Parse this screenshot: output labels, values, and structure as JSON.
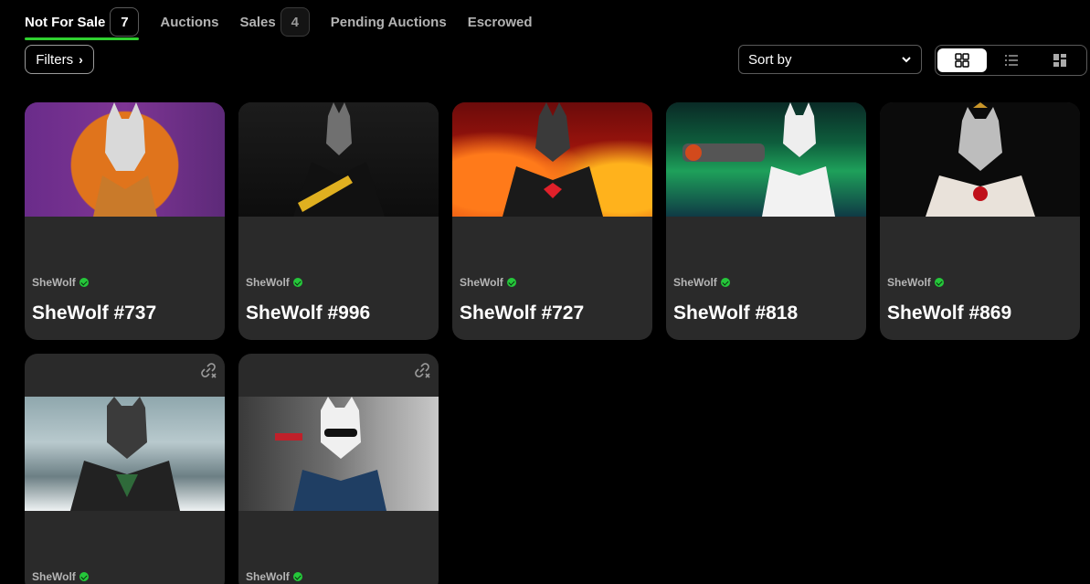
{
  "tabs": [
    {
      "label": "Not For Sale",
      "count": "7",
      "active": true
    },
    {
      "label": "Auctions"
    },
    {
      "label": "Sales",
      "count": "4"
    },
    {
      "label": "Pending Auctions"
    },
    {
      "label": "Escrowed"
    }
  ],
  "filters": {
    "label": "Filters",
    "icon": "chevron-right-icon"
  },
  "sort": {
    "label": "Sort by",
    "icon": "chevron-down-icon"
  },
  "view_modes": [
    "grid-icon",
    "list-icon",
    "masonry-icon"
  ],
  "colors": {
    "accent": "#2fd12f",
    "verified": "#25c73a",
    "card": "#2a2a2a"
  },
  "cards": [
    {
      "collection": "SheWolf",
      "title": "SheWolf #737",
      "art": "art-purple"
    },
    {
      "collection": "SheWolf",
      "title": "SheWolf #996",
      "art": "art-dark"
    },
    {
      "collection": "SheWolf",
      "title": "SheWolf #727",
      "art": "art-fire"
    },
    {
      "collection": "SheWolf",
      "title": "SheWolf #818",
      "art": "art-aurora"
    },
    {
      "collection": "SheWolf",
      "title": "SheWolf #869",
      "art": "art-black"
    },
    {
      "collection": "SheWolf",
      "title": "",
      "art": "art-snow"
    },
    {
      "collection": "SheWolf",
      "title": "",
      "art": "art-city"
    }
  ]
}
